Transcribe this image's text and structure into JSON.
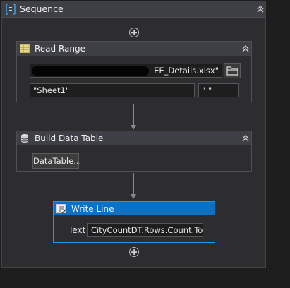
{
  "sequence": {
    "title": "Sequence"
  },
  "read_range": {
    "title": "Read Range",
    "workbook_path": "EE_Details.xlsx\"",
    "sheet_name": "\"Sheet1\"",
    "range": "\" \""
  },
  "build_data_table": {
    "title": "Build Data Table",
    "button_label": "DataTable..."
  },
  "write_line": {
    "title": "Write Line",
    "text_label": "Text",
    "text_value": "CityCountDT.Rows.Count.ToS"
  },
  "colors": {
    "selected_accent": "#1c97ea",
    "selected_header": "#0e70c0",
    "panel_bg": "#2d2d30"
  }
}
